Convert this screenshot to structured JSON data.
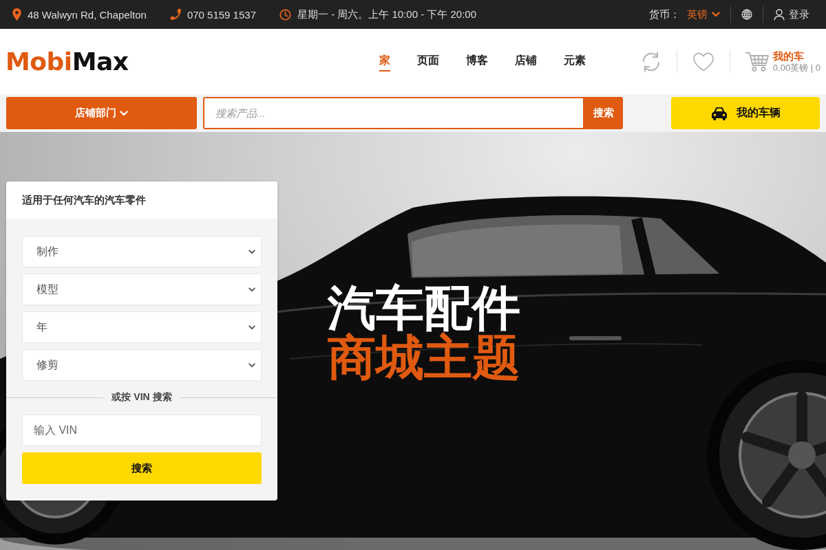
{
  "top_bar": {
    "address": "48 Walwyn Rd, Chapelton",
    "phone": "070 5159 1537",
    "hours": "星期一 - 周六。上午 10:00 - 下午 20:00",
    "currency_label": "货币：",
    "currency": "英镑",
    "login": "登录"
  },
  "header": {
    "logo": {
      "accent": "Mobi",
      "rest": "Max"
    },
    "nav": [
      {
        "label": "家",
        "selected": true
      },
      {
        "label": "页面",
        "selected": false
      },
      {
        "label": "博客",
        "selected": false
      },
      {
        "label": "店铺",
        "selected": false
      },
      {
        "label": "元素",
        "selected": false
      }
    ],
    "cart": {
      "title": "我的车",
      "summary": "0.00英镑 | 0"
    }
  },
  "search_bar": {
    "departments": "店铺部门",
    "placeholder": "搜索产品...",
    "button": "搜索",
    "vehicle_button": "我的车辆"
  },
  "hero": {
    "headline": "汽车配件",
    "highlight": "商城主题"
  },
  "finder": {
    "title": "适用于任何汽车的汽车零件",
    "dropdowns": [
      "制作",
      "模型",
      "年",
      "修剪"
    ],
    "divider": "或按 VIN 搜索",
    "vin_placeholder": "输入 VIN",
    "button": "搜索"
  }
}
